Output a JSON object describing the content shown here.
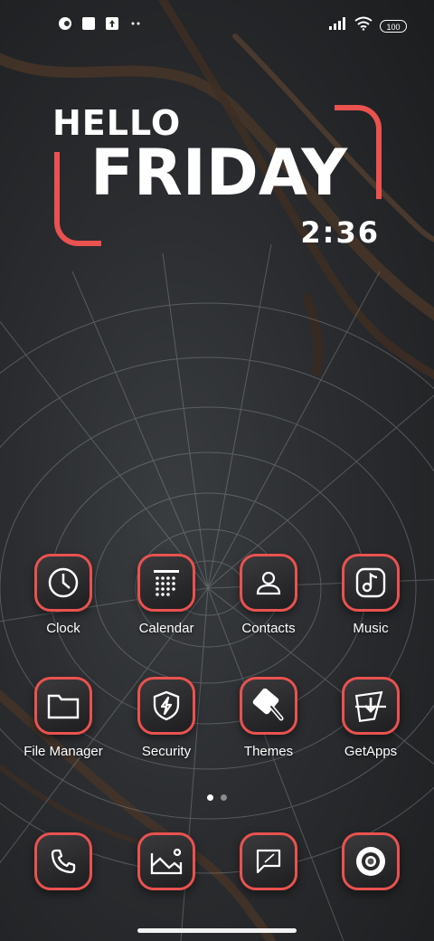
{
  "status_bar": {
    "battery": "100",
    "left_icons": [
      "app-notification-icon",
      "square-notification-icon",
      "upload-notification-icon",
      "more-notifications-icon"
    ],
    "right_icons": [
      "signal-icon",
      "wifi-icon",
      "battery-icon"
    ]
  },
  "widget": {
    "greeting": "HELLO",
    "day": "FRIDAY",
    "time": "2:36",
    "accent_color": "#e9524f"
  },
  "apps": [
    {
      "label": "Clock",
      "icon": "clock-icon"
    },
    {
      "label": "Calendar",
      "icon": "calendar-icon"
    },
    {
      "label": "Contacts",
      "icon": "contacts-icon"
    },
    {
      "label": "Music",
      "icon": "music-icon"
    },
    {
      "label": "File Manager",
      "icon": "folder-icon"
    },
    {
      "label": "Security",
      "icon": "shield-icon"
    },
    {
      "label": "Themes",
      "icon": "brush-icon"
    },
    {
      "label": "GetApps",
      "icon": "getapps-icon"
    }
  ],
  "page_indicator": {
    "pages": 2,
    "current": 1
  },
  "dock": [
    {
      "icon": "phone-icon"
    },
    {
      "icon": "gallery-icon"
    },
    {
      "icon": "messages-icon"
    },
    {
      "icon": "camera-icon"
    }
  ]
}
